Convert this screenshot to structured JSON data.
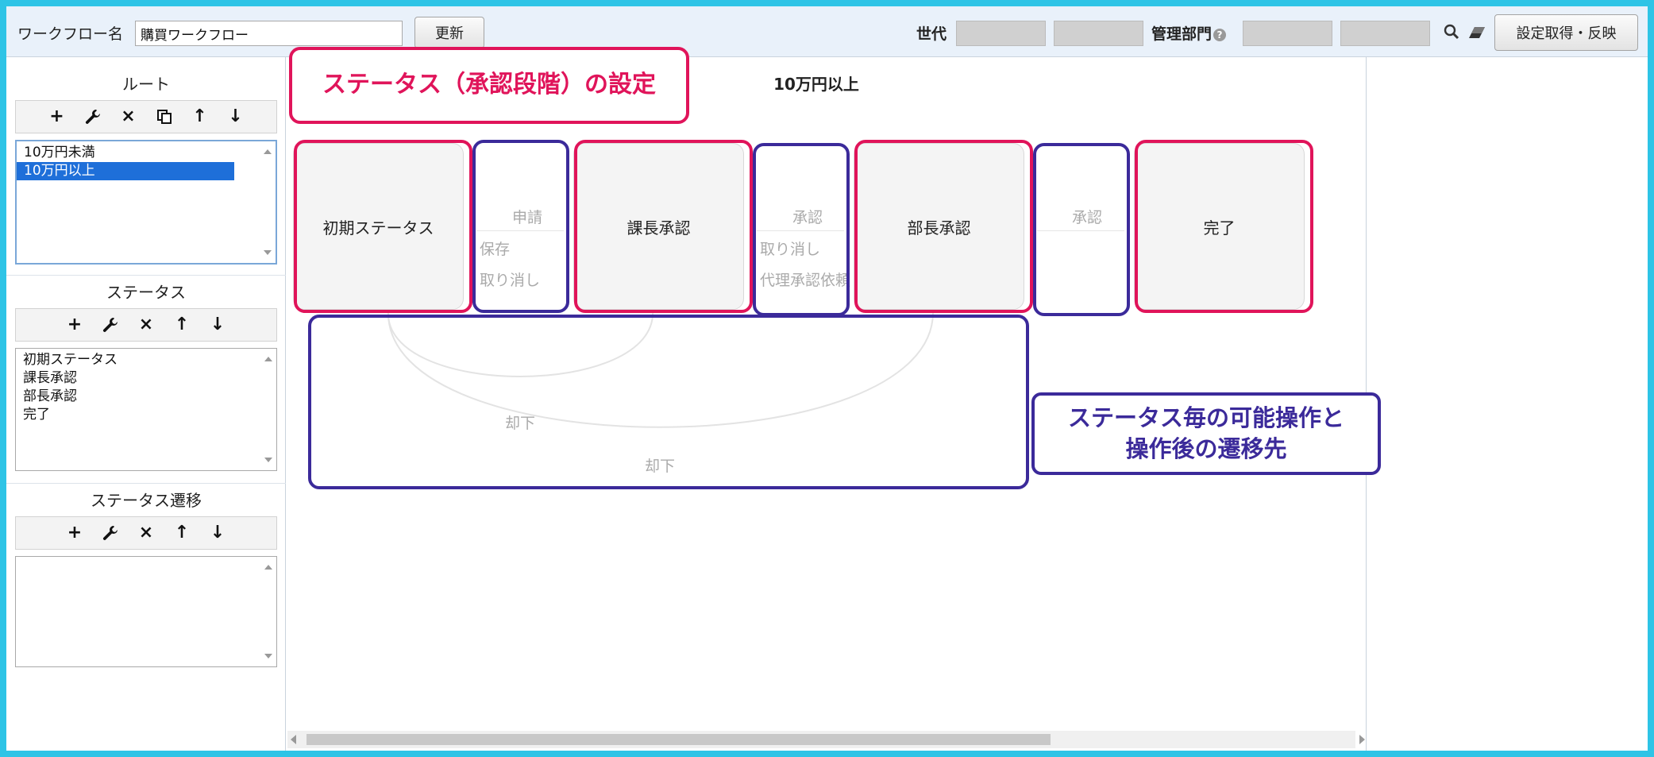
{
  "toolbar": {
    "workflow_label": "ワークフロー名",
    "workflow_value": "購買ワークフロー",
    "update_button": "更新",
    "generation_label": "世代",
    "dept_label": "管理部門",
    "help_symbol": "?",
    "fetch_apply_button": "設定取得・反映"
  },
  "sidebar": {
    "route": {
      "title": "ルート",
      "items": [
        "10万円未満",
        "10万円以上"
      ],
      "selected_index": 1
    },
    "status": {
      "title": "ステータス",
      "items": [
        "初期ステータス",
        "課長承認",
        "部長承認",
        "完了"
      ]
    },
    "transition": {
      "title": "ステータス遷移",
      "items": []
    },
    "icons": {
      "add": "+",
      "close": "×",
      "up": "↑",
      "down": "↓"
    }
  },
  "diagram": {
    "route_title": "10万円以上",
    "nodes": [
      "初期ステータス",
      "課長承認",
      "部長承認",
      "完了"
    ],
    "actions": {
      "apply": "申請",
      "save": "保存",
      "cancel1": "取り消し",
      "approve1": "承認",
      "cancel2": "取り消し",
      "proxy": "代理承認依頼",
      "approve2": "承認",
      "reject1": "却下",
      "reject2": "却下"
    }
  },
  "annotations": {
    "status_setting": "ステータス（承認段階）の設定",
    "ops_line1": "ステータス毎の可能操作と",
    "ops_line2": "操作後の遷移先"
  },
  "colors": {
    "frame": "#2ec4e6",
    "accent_pink": "#e0145a",
    "accent_purple": "#3b2a9a",
    "selection": "#1e6fd9"
  }
}
